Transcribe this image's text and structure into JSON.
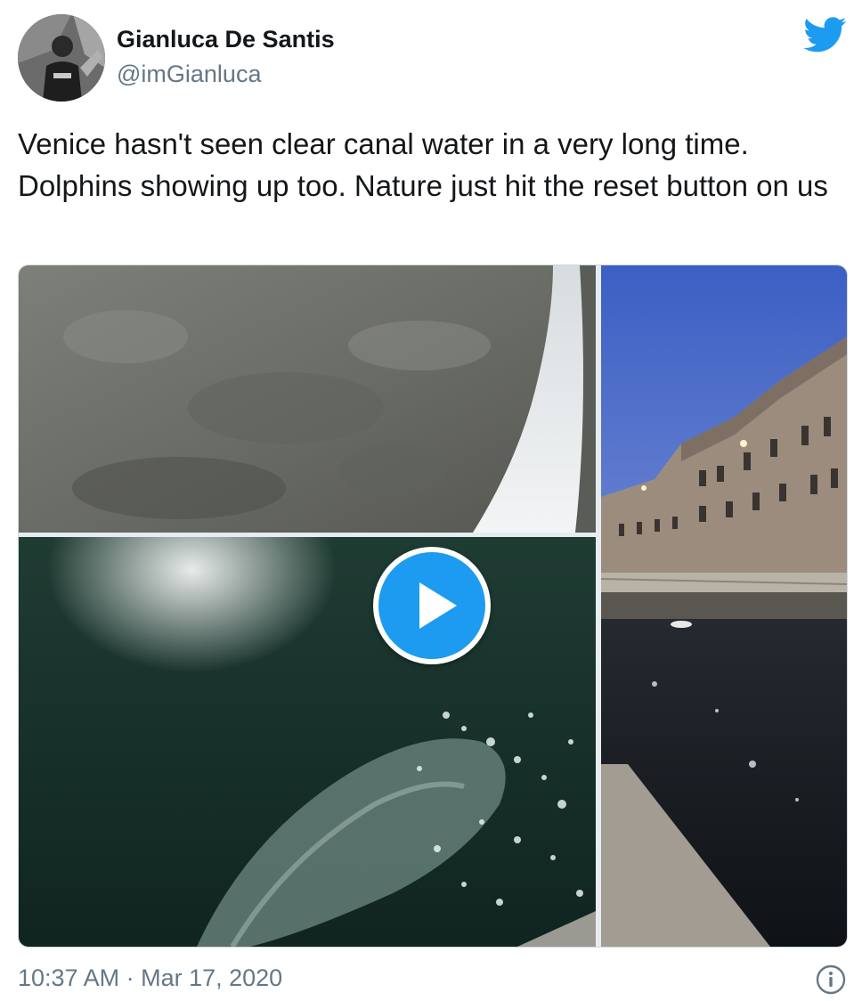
{
  "author": {
    "name": "Gianluca De Santis",
    "handle": "@imGianluca"
  },
  "tweet": {
    "text": "Venice hasn't seen clear canal water in a very long time. Dolphins showing up too. Nature just hit the reset button on us",
    "timestamp": "10:37 AM · Mar 17, 2020"
  },
  "media": {
    "items": [
      {
        "kind": "photo",
        "subject": "rock-wall"
      },
      {
        "kind": "video",
        "subject": "dolphin-in-water",
        "has_play_button": true
      },
      {
        "kind": "photo",
        "subject": "canal-at-dusk"
      }
    ]
  },
  "icons": {
    "logo": "twitter-bird-icon",
    "play": "play-icon",
    "info": "info-icon"
  },
  "colors": {
    "brand_blue": "#1d9bf0",
    "text_primary": "#14171a",
    "text_secondary": "#657786"
  }
}
